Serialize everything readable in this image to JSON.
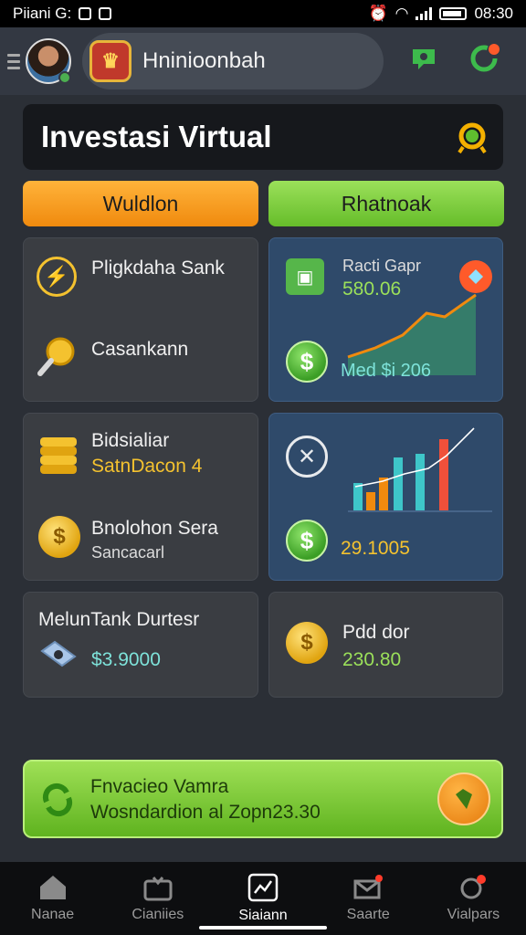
{
  "status_bar": {
    "left_text": "Piiani G:",
    "time": "08:30"
  },
  "topbar": {
    "title": "Hninioonbah"
  },
  "header": {
    "title": "Investasi Virtual"
  },
  "buttons": {
    "left": "Wuldlon",
    "right": "Rhatnoak"
  },
  "cards": {
    "c1": {
      "row1": "Pligkdaha Sank",
      "row2": "Casankann"
    },
    "c2": {
      "title": "Racti Gapr",
      "value": "580.06",
      "footer": "Med $i 206"
    },
    "c3": {
      "title": "Bidsialiar",
      "subtitle": "SatnDacon 4",
      "row2_title": "Bnolohon Sera",
      "row2_sub": "Sancacarl"
    },
    "c4": {
      "value": "29.1005"
    },
    "c5": {
      "title": "MelunTank Durtesr",
      "value": "$3.9000"
    },
    "c6": {
      "title": "Pdd dor",
      "value": "230.80"
    }
  },
  "promo": {
    "title": "Fnvacieo Vamra",
    "subtitle": "Wosndardion al Zopn23.30"
  },
  "nav": [
    {
      "label": "Nanae"
    },
    {
      "label": "Cianiies"
    },
    {
      "label": "Siaiann"
    },
    {
      "label": "Saarte"
    },
    {
      "label": "Vialpars"
    }
  ],
  "colors": {
    "accent_orange": "#f08a0e",
    "accent_green": "#66bd2a",
    "background": "#2b2f36"
  }
}
